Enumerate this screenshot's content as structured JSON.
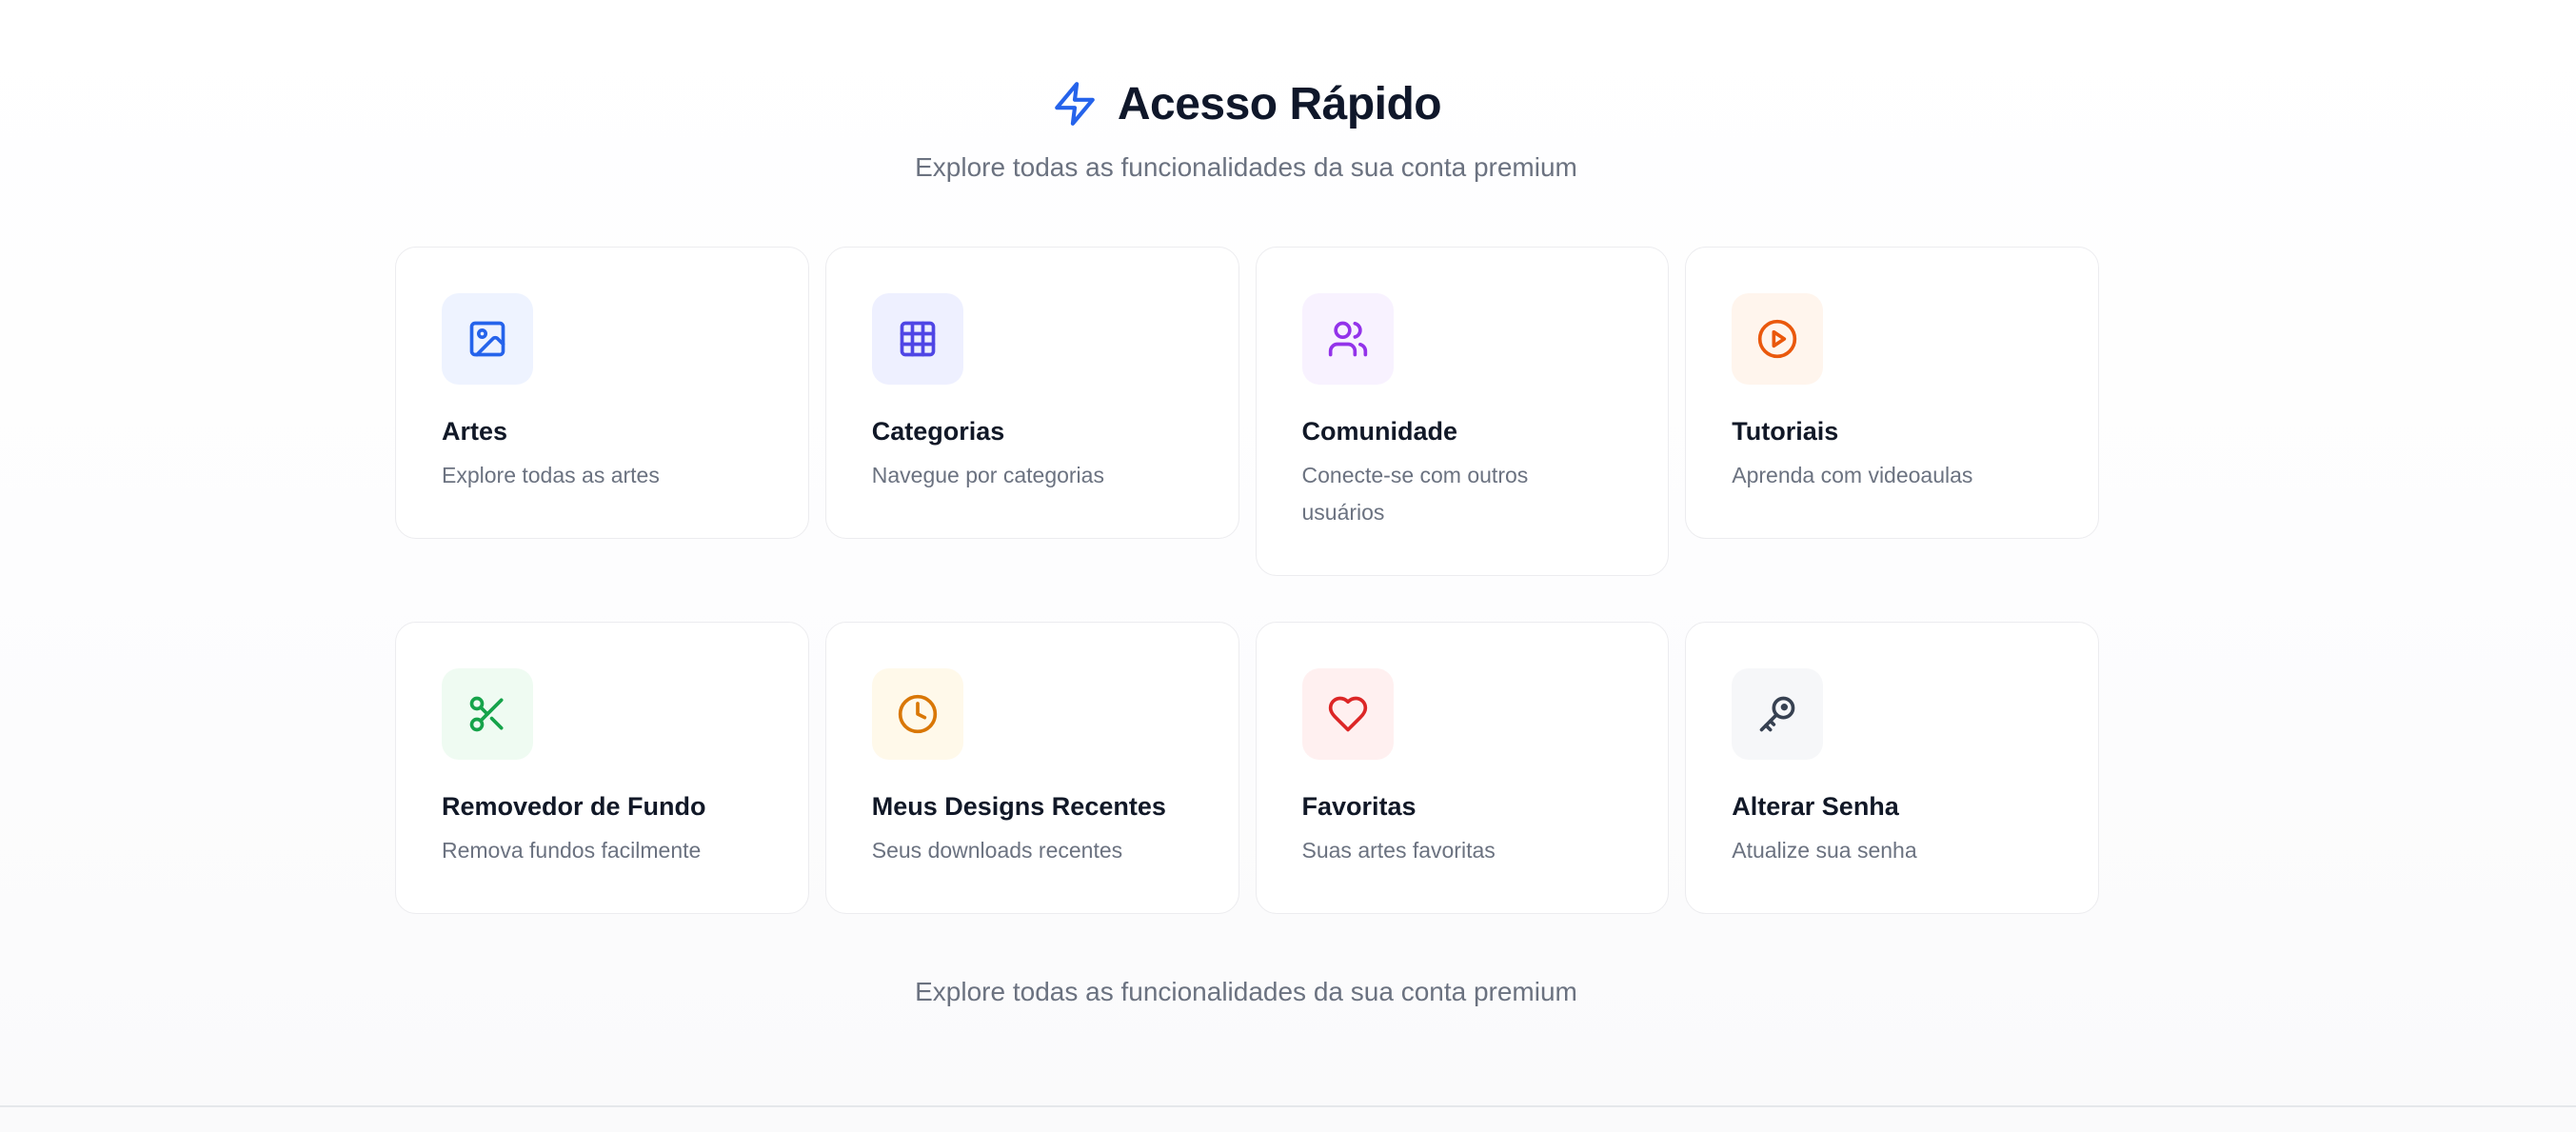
{
  "header": {
    "icon": "lightning-bolt-icon",
    "title": "Acesso Rápido",
    "subtitle": "Explore todas as funcionalidades da sua conta premium"
  },
  "colors": {
    "accent": "#2563eb",
    "title": "#0f172a",
    "muted": "#6b7280"
  },
  "cards": [
    {
      "title": "Artes",
      "description": "Explore todas as artes",
      "icon": "image-icon",
      "icon_color": "#2563eb",
      "icon_bg": "#eef3ff"
    },
    {
      "title": "Categorias",
      "description": "Navegue por categorias",
      "icon": "grid-icon",
      "icon_color": "#4f46e5",
      "icon_bg": "#eef0ff"
    },
    {
      "title": "Comunidade",
      "description": "Conecte-se com outros usuários",
      "icon": "users-icon",
      "icon_color": "#9333ea",
      "icon_bg": "#f8f2ff"
    },
    {
      "title": "Tutoriais",
      "description": "Aprenda com videoaulas",
      "icon": "play-circle-icon",
      "icon_color": "#ea580c",
      "icon_bg": "#fff5ed"
    },
    {
      "title": "Removedor de Fundo",
      "description": "Remova fundos facilmente",
      "icon": "scissors-icon",
      "icon_color": "#16a34a",
      "icon_bg": "#effbf2"
    },
    {
      "title": "Meus Designs Recentes",
      "description": "Seus downloads recentes",
      "icon": "clock-icon",
      "icon_color": "#d97706",
      "icon_bg": "#fff9ea"
    },
    {
      "title": "Favoritas",
      "description": "Suas artes favoritas",
      "icon": "heart-icon",
      "icon_color": "#dc2626",
      "icon_bg": "#fff0f0"
    },
    {
      "title": "Alterar Senha",
      "description": "Atualize sua senha",
      "icon": "key-icon",
      "icon_color": "#374151",
      "icon_bg": "#f6f7f9"
    }
  ],
  "footer": {
    "text": "Explore todas as funcionalidades da sua conta premium"
  }
}
